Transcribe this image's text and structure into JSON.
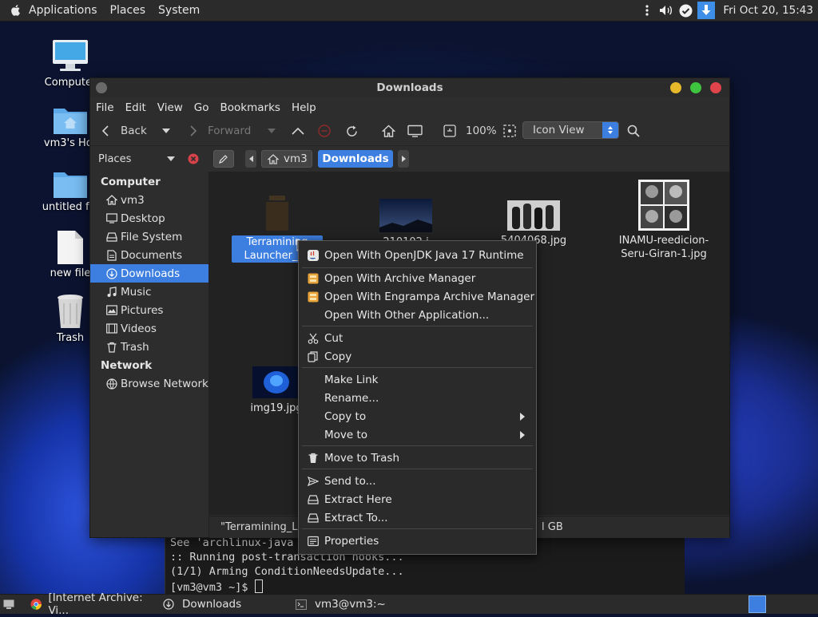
{
  "top_panel": {
    "menus": [
      "Applications",
      "Places",
      "System"
    ],
    "clock": "Fri Oct 20, 15:43",
    "tray_icons": [
      "menu-icon",
      "volume-icon",
      "check-icon",
      "download-icon"
    ]
  },
  "desktop": {
    "icons": [
      {
        "label": "Computer",
        "icon": "computer-icon"
      },
      {
        "label": "vm3's Hor",
        "icon": "home-folder-icon"
      },
      {
        "label": "untitled fol",
        "icon": "folder-icon"
      },
      {
        "label": "new file",
        "icon": "file-icon"
      },
      {
        "label": "Trash",
        "icon": "trash-icon"
      }
    ]
  },
  "terminal": {
    "lines": [
      "See 'archlinux-java",
      ":: Running post-transaction hooks...",
      "(1/1) Arming ConditionNeedsUpdate...",
      "[vm3@vm3 ~]$ "
    ]
  },
  "window": {
    "title": "Downloads",
    "menubar": [
      "File",
      "Edit",
      "View",
      "Go",
      "Bookmarks",
      "Help"
    ],
    "toolbar": {
      "back": "Back",
      "forward": "Forward",
      "zoom": "100%",
      "view_mode": "Icon View"
    },
    "location": {
      "sidebar_mode": "Places",
      "crumbs": [
        "vm3",
        "Downloads"
      ]
    },
    "sidebar": {
      "sections": [
        {
          "title": "Computer",
          "items": [
            {
              "label": "vm3",
              "icon": "home-icon"
            },
            {
              "label": "Desktop",
              "icon": "desktop-icon"
            },
            {
              "label": "File System",
              "icon": "drive-icon"
            },
            {
              "label": "Documents",
              "icon": "documents-icon"
            },
            {
              "label": "Downloads",
              "icon": "download-icon",
              "selected": true
            },
            {
              "label": "Music",
              "icon": "music-icon"
            },
            {
              "label": "Pictures",
              "icon": "pictures-icon"
            },
            {
              "label": "Videos",
              "icon": "videos-icon"
            },
            {
              "label": "Trash",
              "icon": "trash-icon"
            }
          ]
        },
        {
          "title": "Network",
          "items": [
            {
              "label": "Browse Network",
              "icon": "network-icon"
            }
          ]
        }
      ]
    },
    "files": [
      {
        "label_line1": "Terramining",
        "label_line2": "Launcher_v9",
        "type": "jar",
        "selected": true
      },
      {
        "label_line1": "210102.j",
        "label_line2": "",
        "type": "image"
      },
      {
        "label_line1": "5404068.jpg",
        "label_line2": "",
        "type": "image"
      },
      {
        "label_line1": "INAMU-reedicion-",
        "label_line2": "Seru-Giran-1.jpg",
        "type": "image"
      },
      {
        "label_line1": "img19.jpg",
        "label_line2": "",
        "type": "image"
      }
    ],
    "status": {
      "left": "\"Terramining_La",
      "right": "l GB"
    }
  },
  "context_menu": {
    "items": [
      {
        "label": "Open With OpenJDK Java 17 Runtime",
        "icon": "java-icon"
      },
      {
        "sep": true
      },
      {
        "label": "Open With Archive Manager",
        "icon": "archive-icon"
      },
      {
        "label": "Open With Engrampa Archive Manager",
        "icon": "archive-icon"
      },
      {
        "label": "Open With Other Application...",
        "icon": ""
      },
      {
        "sep": true
      },
      {
        "label": "Cut",
        "icon": "scissors-icon"
      },
      {
        "label": "Copy",
        "icon": "copy-icon"
      },
      {
        "sep": true
      },
      {
        "label": "Make Link",
        "icon": ""
      },
      {
        "label": "Rename...",
        "icon": ""
      },
      {
        "label": "Copy to",
        "icon": "",
        "submenu": true
      },
      {
        "label": "Move to",
        "icon": "",
        "submenu": true
      },
      {
        "sep": true
      },
      {
        "label": "Move to Trash",
        "icon": "trash-icon"
      },
      {
        "sep": true
      },
      {
        "label": "Send to...",
        "icon": "send-icon"
      },
      {
        "label": "Extract Here",
        "icon": "extract-icon"
      },
      {
        "label": "Extract To...",
        "icon": "extract-icon"
      },
      {
        "sep": true
      },
      {
        "label": "Properties",
        "icon": "properties-icon"
      }
    ]
  },
  "taskbar": {
    "tasks": [
      {
        "label": "[Internet Archive: Vi...",
        "icon": "chrome-icon"
      },
      {
        "label": "Downloads",
        "icon": "download-icon"
      },
      {
        "label": "vm3@vm3:~",
        "icon": "terminal-icon"
      }
    ]
  },
  "colors": {
    "accent": "#3d7fe0",
    "close": "#e0444b",
    "minimize": "#e6b82a",
    "maximize": "#3ec43e"
  }
}
